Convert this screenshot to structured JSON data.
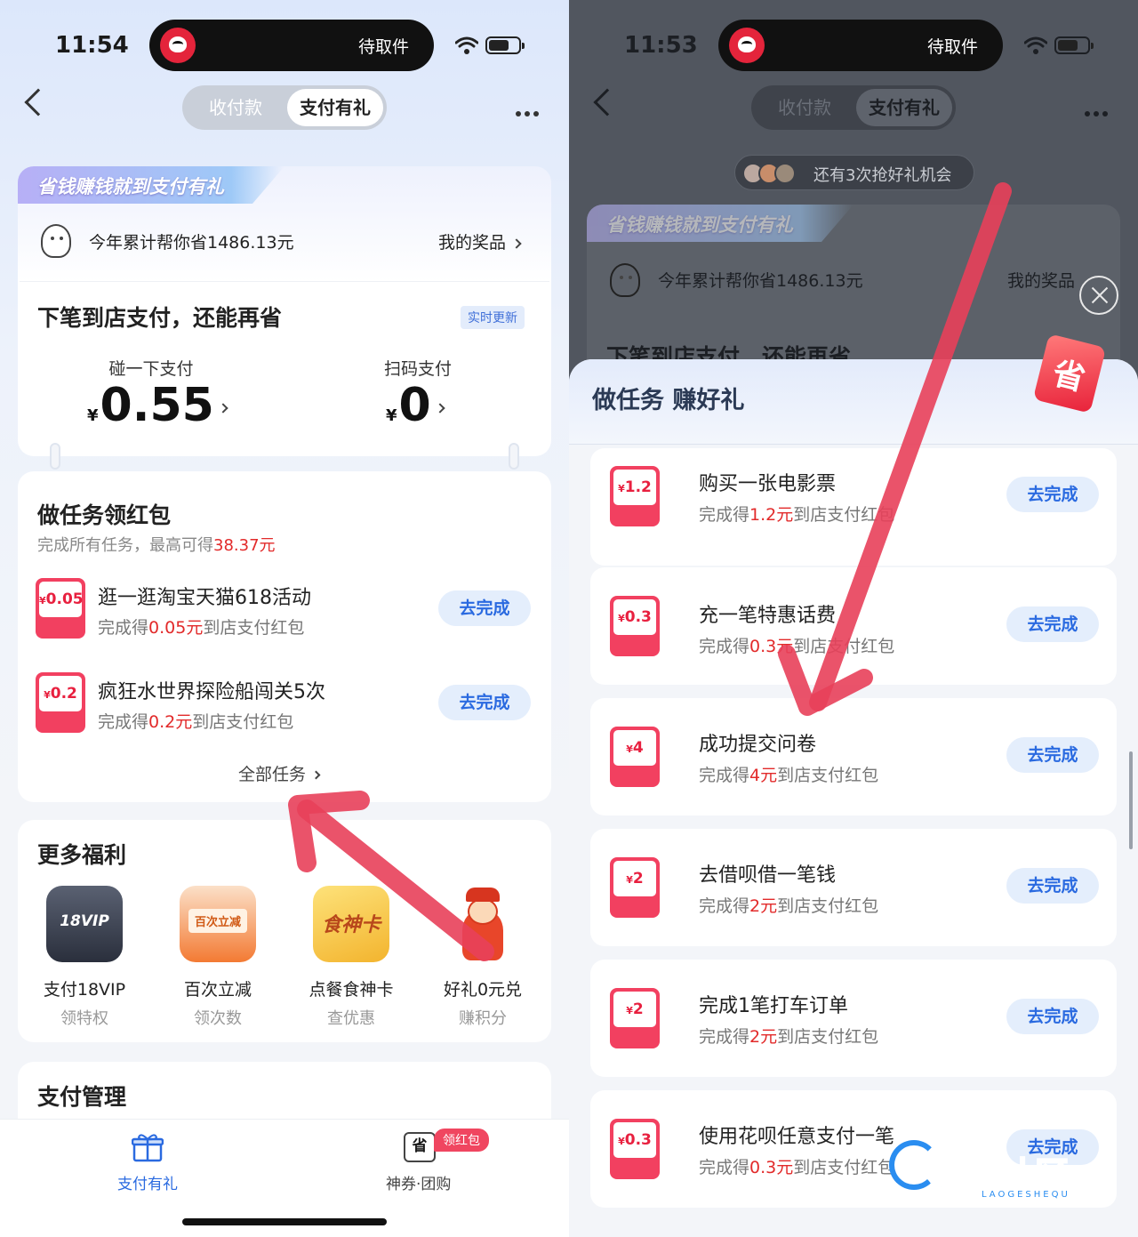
{
  "left": {
    "status": {
      "time": "11:54",
      "island_text": "待取件"
    },
    "nav": {
      "tab_inactive": "收付款",
      "tab_active": "支付有礼"
    },
    "banner": "省钱赚钱就到支付有礼",
    "savings": {
      "text": "今年累计帮你省1486.13元",
      "prizes": "我的奖品"
    },
    "next_pay": {
      "title": "下笔到店支付，还能再省",
      "tag": "实时更新",
      "items": [
        {
          "label": "碰一下支付",
          "currency": "¥",
          "value": "0.55"
        },
        {
          "label": "扫码支付",
          "currency": "¥",
          "value": "0"
        }
      ]
    },
    "tasks": {
      "title": "做任务领红包",
      "subtitle_prefix": "完成所有任务，最高可得",
      "subtitle_amount": "38.37元",
      "items": [
        {
          "coupon_currency": "¥",
          "coupon": "0.05",
          "title": "逛一逛淘宝天猫618活动",
          "sub_prefix": "完成得",
          "amount": "0.05元",
          "sub_suffix": "到店支付红包",
          "button": "去完成"
        },
        {
          "coupon_currency": "¥",
          "coupon": "0.2",
          "title": "疯狂水世界探险船闯关5次",
          "sub_prefix": "完成得",
          "amount": "0.2元",
          "sub_suffix": "到店支付红包",
          "button": "去完成"
        }
      ],
      "all": "全部任务"
    },
    "benefits": {
      "title": "更多福利",
      "items": [
        {
          "icon": "vip-card-icon",
          "icon_text": "18VIP",
          "name": "支付18VIP",
          "desc": "领特权"
        },
        {
          "icon": "discount-tag-icon",
          "icon_text": "百次立减",
          "name": "百次立减",
          "desc": "领次数"
        },
        {
          "icon": "food-card-icon",
          "icon_text": "食神卡",
          "name": "点餐食神卡",
          "desc": "查优惠"
        },
        {
          "icon": "fortune-god-icon",
          "icon_text": "",
          "name": "好礼0元兑",
          "desc": "赚积分"
        }
      ]
    },
    "pay_mgmt": {
      "title": "支付管理"
    },
    "tabbar": {
      "items": [
        {
          "label": "支付有礼",
          "icon": "gift-icon",
          "active": true
        },
        {
          "label": "神券·团购",
          "icon": "voucher-icon",
          "active": false,
          "badge": "领红包",
          "icon_text": "省"
        }
      ]
    }
  },
  "right": {
    "status": {
      "time": "11:53",
      "island_text": "待取件"
    },
    "nav": {
      "tab_inactive": "收付款",
      "tab_active": "支付有礼"
    },
    "chances": "还有3次抢好礼机会",
    "banner": "省钱赚钱就到支付有礼",
    "savings": {
      "text": "今年累计帮你省1486.13元",
      "prizes": "我的奖品"
    },
    "behind_title": "下笔到店支付，还能再省",
    "sheet": {
      "title": "做任务 赚好礼",
      "badge": "省",
      "tasks": [
        {
          "coupon_currency": "¥",
          "coupon": "1.2",
          "title": "购买一张电影票",
          "sub_prefix": "完成得",
          "amount": "1.2元",
          "sub_suffix": "到店支付红包",
          "button": "去完成"
        },
        {
          "coupon_currency": "¥",
          "coupon": "0.3",
          "title": "充一笔特惠话费",
          "sub_prefix": "完成得",
          "amount": "0.3元",
          "sub_suffix": "到店支付红包",
          "button": "去完成"
        },
        {
          "coupon_currency": "¥",
          "coupon": "4",
          "title": "成功提交问卷",
          "sub_prefix": "完成得",
          "amount": "4元",
          "sub_suffix": "到店支付红包",
          "button": "去完成"
        },
        {
          "coupon_currency": "¥",
          "coupon": "2",
          "title": "去借呗借一笔钱",
          "sub_prefix": "完成得",
          "amount": "2元",
          "sub_suffix": "到店支付红包",
          "button": "去完成"
        },
        {
          "coupon_currency": "¥",
          "coupon": "2",
          "title": "完成1笔打车订单",
          "sub_prefix": "完成得",
          "amount": "2元",
          "sub_suffix": "到店支付红包",
          "button": "去完成"
        },
        {
          "coupon_currency": "¥",
          "coupon": "0.3",
          "title": "使用花呗任意支付一笔",
          "sub_prefix": "完成得",
          "amount": "0.3元",
          "sub_suffix": "到店支付红包",
          "button": "去完成"
        }
      ]
    },
    "watermark": {
      "text": "老哥社区",
      "sub": "LAOGESHEQU"
    }
  },
  "colors": {
    "accent_red": "#e22a2a",
    "button_blue": "#2a6ae0",
    "coupon_red": "#f24060",
    "annotation_arrow": "#e8405a"
  }
}
